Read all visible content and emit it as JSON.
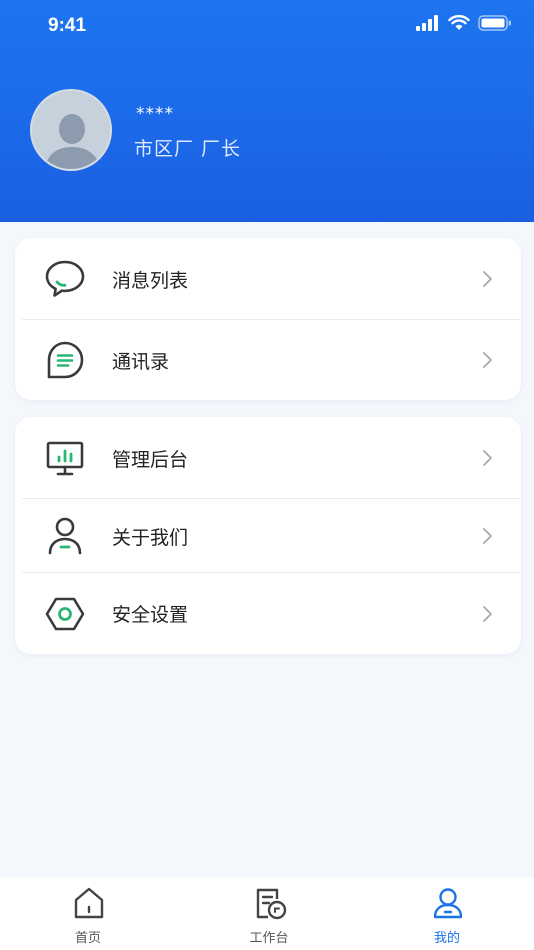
{
  "status_bar": {
    "time": "9:41"
  },
  "profile": {
    "name": "****",
    "role": "市区厂 厂长"
  },
  "menu_group_1": [
    {
      "label": "消息列表",
      "icon": "chat-bubble-icon"
    },
    {
      "label": "通讯录",
      "icon": "contacts-icon"
    }
  ],
  "menu_group_2": [
    {
      "label": "管理后台",
      "icon": "monitor-chart-icon"
    },
    {
      "label": "关于我们",
      "icon": "person-icon"
    },
    {
      "label": "安全设置",
      "icon": "hexagon-shield-icon"
    }
  ],
  "tabbar": {
    "home": "首页",
    "workbench": "工作台",
    "mine": "我的",
    "active": "mine"
  },
  "colors": {
    "header_blue": "#1c6ae9",
    "accent_green": "#2bb673",
    "active_tab": "#1a73e8"
  }
}
